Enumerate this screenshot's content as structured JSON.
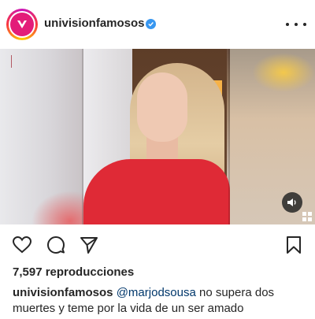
{
  "header": {
    "username": "univisionfamosos",
    "avatar_icon": "univision-logo-icon",
    "verified_icon": "verified-badge-icon",
    "more_icon": "more-options-icon",
    "brand_color": "#e31c79",
    "verified_color": "#3897f0"
  },
  "media": {
    "type": "video",
    "sound_icon": "speaker-icon",
    "watermark_icon": "univision-logo-icon"
  },
  "actions": {
    "like_icon": "heart-icon",
    "comment_icon": "comment-icon",
    "share_icon": "send-icon",
    "save_icon": "bookmark-icon"
  },
  "stats": {
    "views": "7,597 reproducciones"
  },
  "caption": {
    "username": "univisionfamosos",
    "mention": "@marjodsousa",
    "text": " no supera dos muertes y teme por la vida de un ser amado"
  },
  "colors": {
    "mention": "#00376b",
    "text": "#262626"
  }
}
